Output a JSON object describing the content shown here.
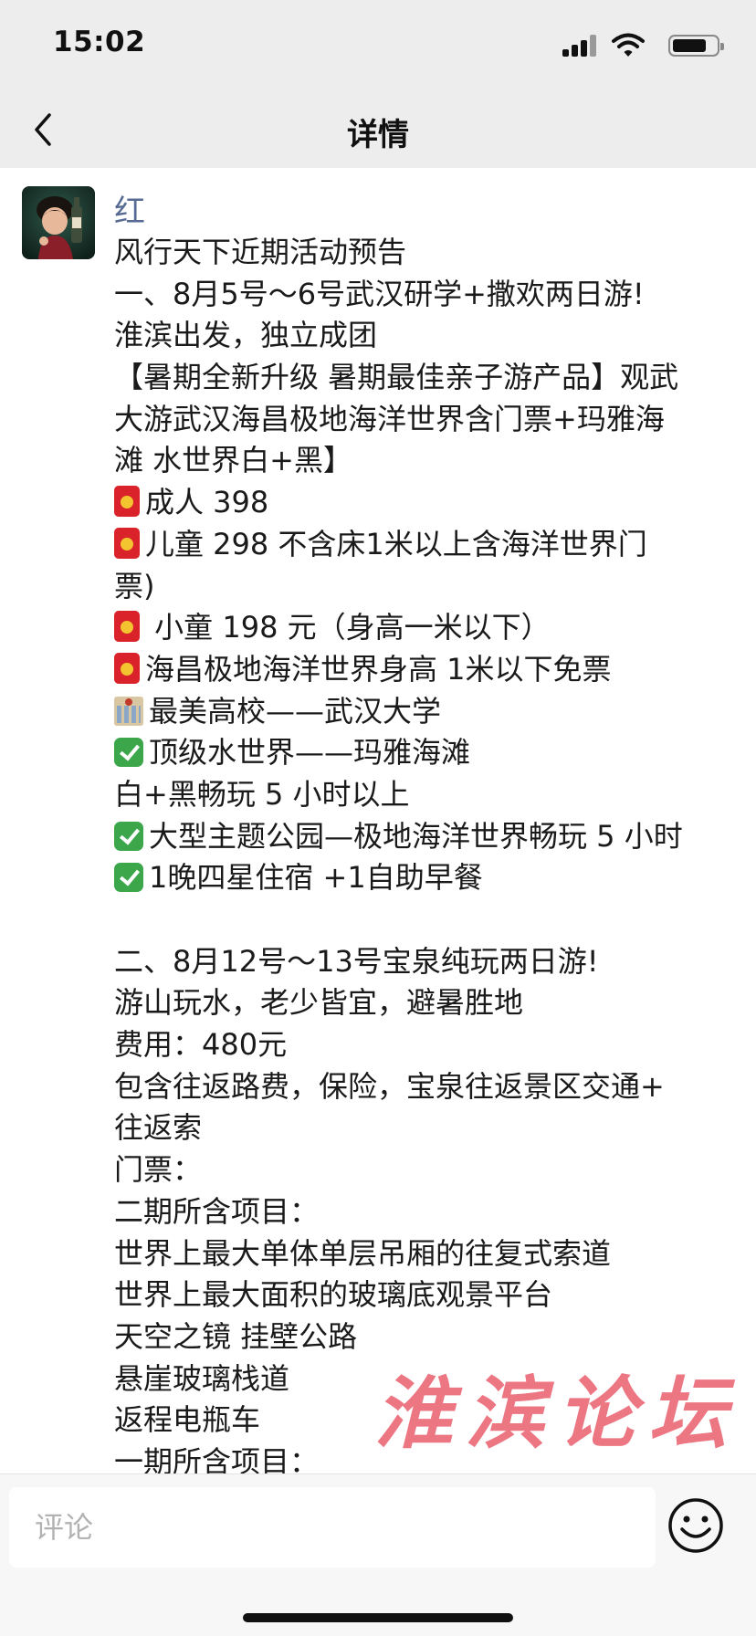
{
  "status_bar": {
    "time": "15:02",
    "icons": [
      "signal-icon",
      "wifi-icon",
      "battery-icon"
    ]
  },
  "nav": {
    "title": "详情",
    "back_icon": "chevron-left-icon"
  },
  "post": {
    "author": "红",
    "avatar_icon": "avatar",
    "lines": [
      {
        "icon": "",
        "text": "风行天下近期活动预告"
      },
      {
        "icon": "",
        "text": "一、8月5号～6号武汉研学+撒欢两日游!"
      },
      {
        "icon": "",
        "text": "淮滨出发，独立成团"
      },
      {
        "icon": "",
        "text": "【暑期全新升级 暑期最佳亲子游产品】观武"
      },
      {
        "icon": "",
        "text": "大游武汉海昌极地海洋世界含门票+玛雅海"
      },
      {
        "icon": "",
        "text": "滩 水世界白+黑】"
      },
      {
        "icon": "red-envelope",
        "text": "成人 398"
      },
      {
        "icon": "red-envelope",
        "text": "儿童 298 不含床1米以上含海洋世界门"
      },
      {
        "icon": "",
        "text": "票)"
      },
      {
        "icon": "red-envelope",
        "text": " 小童 198 元（身高一米以下）"
      },
      {
        "icon": "red-envelope",
        "text": "海昌极地海洋世界身高 1米以下免票"
      },
      {
        "icon": "school",
        "text": "最美高校——武汉大学"
      },
      {
        "icon": "check",
        "text": "顶级水世界——玛雅海滩"
      },
      {
        "icon": "",
        "text": "白+黑畅玩 5 小时以上"
      },
      {
        "icon": "check",
        "text": "大型主题公园—极地海洋世界畅玩 5 小时"
      },
      {
        "icon": "check",
        "text": "1晚四星住宿 +1自助早餐"
      },
      {
        "icon": "",
        "text": ""
      },
      {
        "icon": "",
        "text": "二、8月12号～13号宝泉纯玩两日游!"
      },
      {
        "icon": "",
        "text": "游山玩水，老少皆宜，避暑胜地"
      },
      {
        "icon": "",
        "text": "费用：480元"
      },
      {
        "icon": "",
        "text": "包含往返路费，保险，宝泉往返景区交通+"
      },
      {
        "icon": "",
        "text": "往返索"
      },
      {
        "icon": "",
        "text": "门票："
      },
      {
        "icon": "",
        "text": "二期所含项目："
      },
      {
        "icon": "",
        "text": "世界上最大单体单层吊厢的往复式索道"
      },
      {
        "icon": "",
        "text": "世界上最大面积的玻璃底观景平台"
      },
      {
        "icon": "",
        "text": "天空之镜 挂壁公路"
      },
      {
        "icon": "",
        "text": "悬崖玻璃栈道"
      },
      {
        "icon": "",
        "text": "返程电瓶车"
      },
      {
        "icon": "",
        "text": "一期所含项目："
      }
    ]
  },
  "watermark": "淮滨论坛",
  "comment": {
    "placeholder": "评论",
    "emoji_icon": "smiley-face-icon"
  }
}
